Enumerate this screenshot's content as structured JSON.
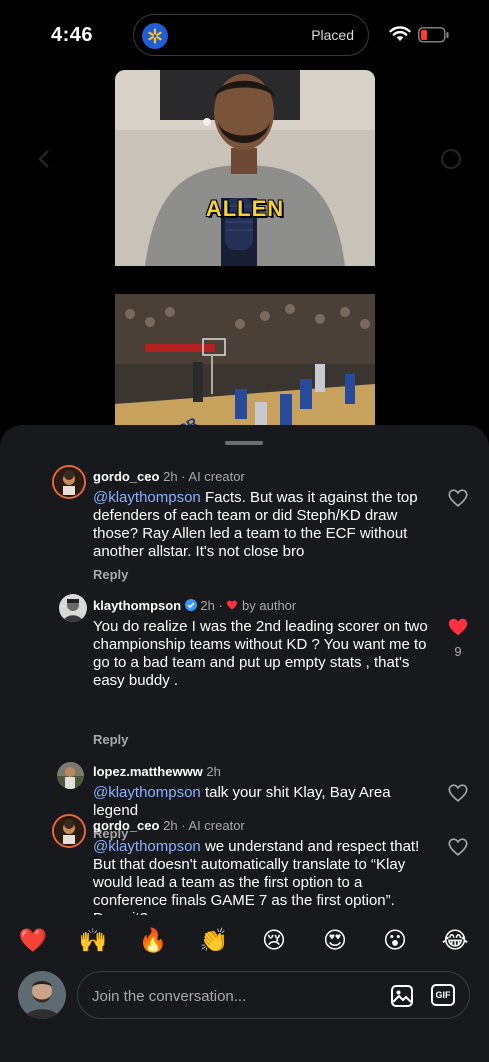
{
  "status_bar": {
    "time": "4:46",
    "live_activity_label": "Placed",
    "icons": [
      "walmart-spark-icon",
      "wifi-icon",
      "battery-low-icon"
    ]
  },
  "video": {
    "caption": "ALLEN",
    "icons": [
      "speaker-icon"
    ]
  },
  "comments": [
    {
      "user": "gordo_ceo",
      "time": "2h",
      "tag": "· AI creator",
      "mention": "@klaythompson",
      "text": " Facts. But was it against the top defenders of each team or did Steph/KD draw those? Ray Allen led a team to the ECF without another allstar. It's not close bro",
      "reply_label": "Reply",
      "liked": false
    },
    {
      "user": "klaythompson",
      "time": "2h ·",
      "author_label": "by author",
      "mention": "",
      "text": "You do realize I was the 2nd leading scorer on two championship teams without KD ? You want me to go to a bad team and put up empty stats , that's easy buddy .",
      "reply_label": "Reply",
      "liked": true,
      "like_count": "9"
    },
    {
      "user": "lopez.matthewww",
      "time": "2h",
      "mention": "@klaythompson",
      "text": " talk your shit Klay, Bay Area legend",
      "reply_label": "Reply",
      "liked": false
    },
    {
      "user": "gordo_ceo",
      "time": "2h",
      "tag": "· AI creator",
      "mention": "@klaythompson",
      "text": " we understand and respect that! But that doesn't automatically translate to “Klay would lead a team as the first option to a conference finals GAME 7 as the first option”. Does it?",
      "liked": false
    }
  ],
  "reactions": [
    "❤️",
    "🙌",
    "🔥",
    "👏",
    "😢",
    "😍",
    "😮",
    "😂"
  ],
  "composer": {
    "placeholder": "Join the conversation...",
    "gif_label": "GIF"
  },
  "colors": {
    "sheet_bg": "#18191c",
    "mention": "#8ab0ff",
    "like_active": "#ff3040",
    "caption": "#f7d13a"
  }
}
